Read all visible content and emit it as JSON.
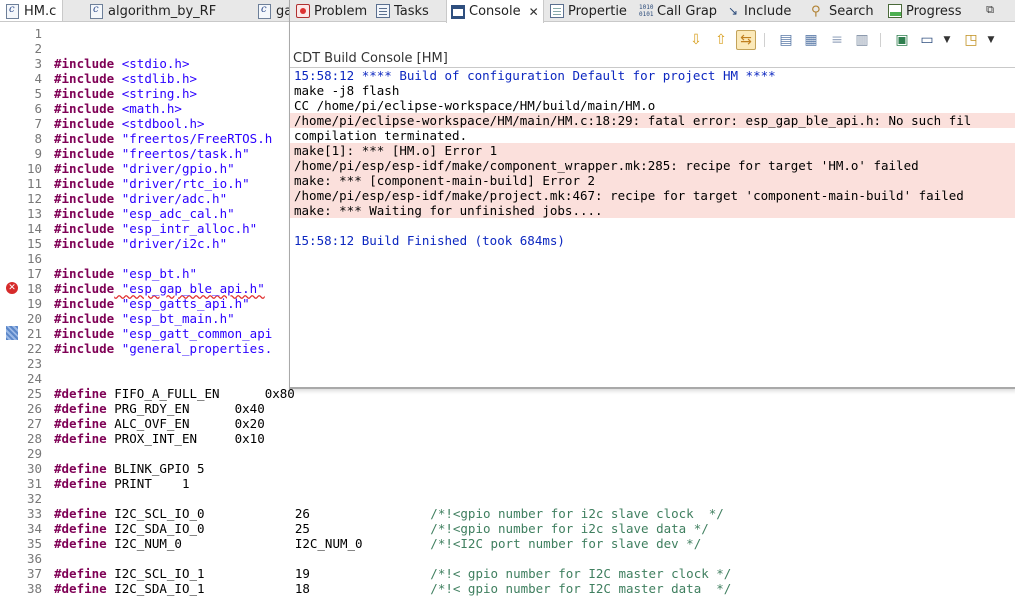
{
  "editor": {
    "tabs": [
      {
        "label": "HM.c",
        "active": true,
        "icon": "c-file-icon"
      },
      {
        "label": "algorithm_by_RF",
        "active": false,
        "icon": "c-file-icon"
      },
      {
        "label": "gat",
        "active": false,
        "icon": "c-file-icon"
      }
    ],
    "lines": [
      {
        "n": "1",
        "kw": "",
        "s": "",
        "c": ""
      },
      {
        "n": "2",
        "kw": "",
        "s": "",
        "c": ""
      },
      {
        "n": "3",
        "kw": "#include",
        "s": "<stdio.h>",
        "c": ""
      },
      {
        "n": "4",
        "kw": "#include",
        "s": "<stdlib.h>",
        "c": ""
      },
      {
        "n": "5",
        "kw": "#include",
        "s": "<string.h>",
        "c": ""
      },
      {
        "n": "6",
        "kw": "#include",
        "s": "<math.h>",
        "c": ""
      },
      {
        "n": "7",
        "kw": "#include",
        "s": "<stdbool.h>",
        "c": ""
      },
      {
        "n": "8",
        "kw": "#include",
        "s": "\"freertos/FreeRTOS.h",
        "c": ""
      },
      {
        "n": "9",
        "kw": "#include",
        "s": "\"freertos/task.h\"",
        "c": ""
      },
      {
        "n": "10",
        "kw": "#include",
        "s": "\"driver/gpio.h\"",
        "c": ""
      },
      {
        "n": "11",
        "kw": "#include",
        "s": "\"driver/rtc_io.h\"",
        "c": ""
      },
      {
        "n": "12",
        "kw": "#include",
        "s": "\"driver/adc.h\"",
        "c": ""
      },
      {
        "n": "13",
        "kw": "#include",
        "s": "\"esp_adc_cal.h\"",
        "c": ""
      },
      {
        "n": "14",
        "kw": "#include",
        "s": "\"esp_intr_alloc.h\"",
        "c": ""
      },
      {
        "n": "15",
        "kw": "#include",
        "s": "\"driver/i2c.h\"",
        "c": ""
      },
      {
        "n": "16",
        "kw": "",
        "s": "",
        "c": ""
      },
      {
        "n": "17",
        "kw": "#include",
        "s": "\"esp_bt.h\"",
        "c": ""
      },
      {
        "n": "18",
        "kw": "#include",
        "s": "\"esp_gap_ble_api.h\"",
        "c": "",
        "error": true
      },
      {
        "n": "19",
        "kw": "#include",
        "s": "\"esp_gatts_api.h\"",
        "c": ""
      },
      {
        "n": "20",
        "kw": "#include",
        "s": "\"esp_bt_main.h\"",
        "c": ""
      },
      {
        "n": "21",
        "kw": "#include",
        "s": "\"esp_gatt_common_api",
        "c": "",
        "mark": true
      },
      {
        "n": "22",
        "kw": "#include",
        "s": "\"general_properties.",
        "c": ""
      },
      {
        "n": "23",
        "kw": "",
        "s": "",
        "c": ""
      },
      {
        "n": "24",
        "kw": "",
        "s": "",
        "c": ""
      },
      {
        "n": "25",
        "kw": "#define",
        "s": " FIFO_A_FULL_EN      0x80",
        "c": ""
      },
      {
        "n": "26",
        "kw": "#define",
        "s": " PRG_RDY_EN      0x40",
        "c": ""
      },
      {
        "n": "27",
        "kw": "#define",
        "s": " ALC_OVF_EN      0x20",
        "c": ""
      },
      {
        "n": "28",
        "kw": "#define",
        "s": " PROX_INT_EN     0x10",
        "c": ""
      },
      {
        "n": "29",
        "kw": "",
        "s": "",
        "c": ""
      },
      {
        "n": "30",
        "kw": "#define",
        "s": " BLINK_GPIO 5",
        "c": ""
      },
      {
        "n": "31",
        "kw": "#define",
        "s": " PRINT    1",
        "c": ""
      },
      {
        "n": "32",
        "kw": "",
        "s": "",
        "c": ""
      },
      {
        "n": "33",
        "kw": "#define",
        "s": " I2C_SCL_IO_0            26                ",
        "c": "/*!<gpio number for i2c slave clock  */"
      },
      {
        "n": "34",
        "kw": "#define",
        "s": " I2C_SDA_IO_0            25                ",
        "c": "/*!<gpio number for i2c slave data */"
      },
      {
        "n": "35",
        "kw": "#define",
        "s": " I2C_NUM_0               I2C_NUM_0         ",
        "c": "/*!<I2C port number for slave dev */"
      },
      {
        "n": "36",
        "kw": "",
        "s": "",
        "c": ""
      },
      {
        "n": "37",
        "kw": "#define",
        "s": " I2C_SCL_IO_1            19                ",
        "c": "/*!< gpio number for I2C master clock */"
      },
      {
        "n": "38",
        "kw": "#define",
        "s": " I2C_SDA_IO_1            18                ",
        "c": "/*!< gpio number for I2C master data  */"
      }
    ]
  },
  "view": {
    "tabs": [
      {
        "label": "Problem",
        "icon": "problems-icon"
      },
      {
        "label": "Tasks",
        "icon": "tasks-icon"
      },
      {
        "label": "Console",
        "icon": "console-icon",
        "active": true
      },
      {
        "label": "Propertie",
        "icon": "properties-icon"
      },
      {
        "label": "Call Grap",
        "icon": "call-graph-icon"
      },
      {
        "label": "Include",
        "icon": "include-browser-icon"
      },
      {
        "label": "Search",
        "icon": "search-icon"
      },
      {
        "label": "Progress",
        "icon": "progress-icon"
      }
    ],
    "console_title": "CDT Build Console [HM]",
    "console_lines": [
      {
        "text": "15:58:12 **** Build of configuration Default for project HM ****",
        "style": "blue"
      },
      {
        "text": "make -j8 flash",
        "style": "normal"
      },
      {
        "text": "CC /home/pi/eclipse-workspace/HM/build/main/HM.o",
        "style": "normal"
      },
      {
        "text": "/home/pi/eclipse-workspace/HM/main/HM.c:18:29: fatal error: esp_gap_ble_api.h: No such fil",
        "style": "error"
      },
      {
        "text": "compilation terminated.",
        "style": "normal"
      },
      {
        "text": "make[1]: *** [HM.o] Error 1",
        "style": "error"
      },
      {
        "text": "/home/pi/esp/esp-idf/make/component_wrapper.mk:285: recipe for target 'HM.o' failed",
        "style": "error"
      },
      {
        "text": "make: *** [component-main-build] Error 2",
        "style": "error"
      },
      {
        "text": "/home/pi/esp/esp-idf/make/project.mk:467: recipe for target 'component-main-build' failed",
        "style": "error"
      },
      {
        "text": "make: *** Waiting for unfinished jobs....",
        "style": "error"
      },
      {
        "text": "",
        "style": "normal"
      },
      {
        "text": "15:58:12 Build Finished (took 684ms)",
        "style": "blue"
      }
    ],
    "toolbar_icons": [
      "next-annotation-icon",
      "previous-annotation-icon",
      "link-with-editor-icon",
      "copy-build-log-icon",
      "open-console-icon",
      "scroll-lock-icon",
      "clear-console-icon",
      "pin-console-icon",
      "display-selected-console-icon",
      "new-console-icon"
    ],
    "restore_icon": "restore-icon"
  },
  "colors": {
    "keyword": "#7f0055",
    "string": "#2a00ff",
    "comment": "#3f7f5f",
    "error_bg": "#fbe0dc",
    "console_info": "#0c27c0"
  }
}
